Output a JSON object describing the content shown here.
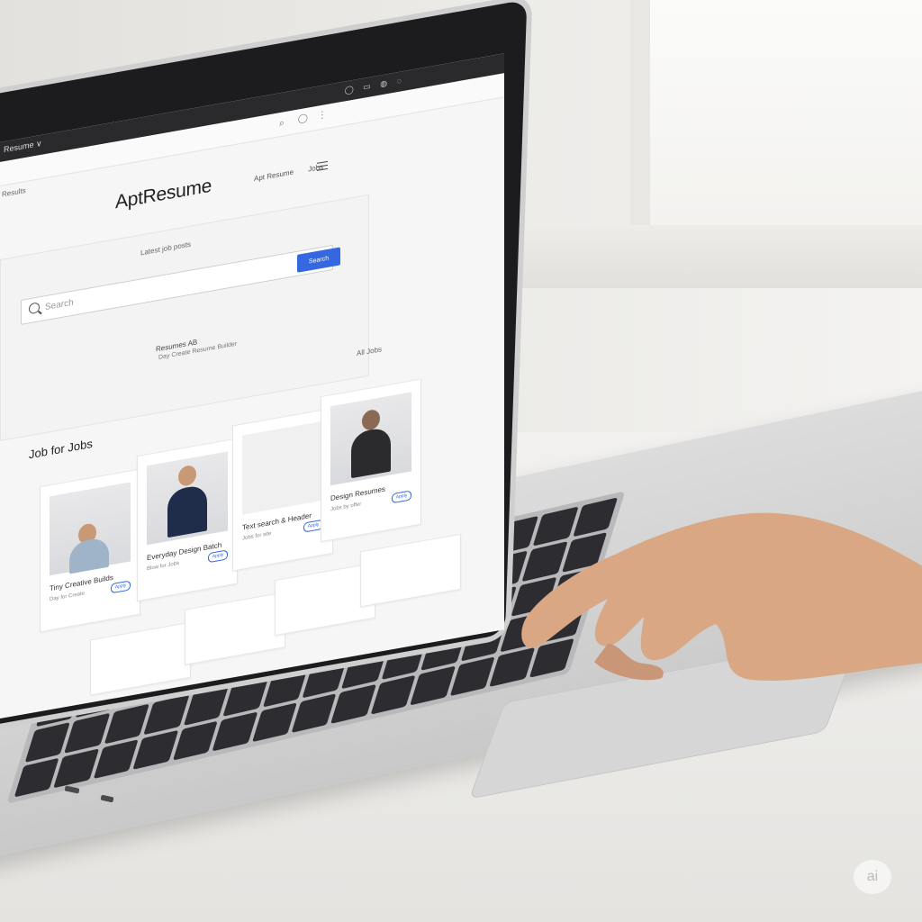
{
  "browser": {
    "tab_label": "Resume ∨",
    "bookmark_label": "Results"
  },
  "site": {
    "logo": "AptResume",
    "nav": [
      "Apt Resume",
      "Jobs"
    ],
    "hero_caption": "Latest job posts",
    "search_placeholder": "Search",
    "search_button": "Search",
    "hero_sub1": "Resumes AB",
    "hero_sub2": "Day Create Resume Builder",
    "filter_label": "All Jobs",
    "section_title": "Job for Jobs",
    "cards": [
      {
        "name": "Tiny Creative Builds",
        "meta": "Day for Create",
        "pill": "Apply"
      },
      {
        "name": "Everyday Design Batch",
        "meta": "Blow for Jobs",
        "pill": "Apply"
      },
      {
        "name": "Text search & Header",
        "meta": "Jobs for site",
        "pill": "Apply"
      },
      {
        "name": "Design Resumes",
        "meta": "Jobs by offer",
        "pill": "Apply"
      }
    ]
  },
  "watermark": "ai",
  "colors": {
    "accent": "#3568e0",
    "screen_bg": "#f6f6f6",
    "bezel": "#1c1c1f"
  }
}
